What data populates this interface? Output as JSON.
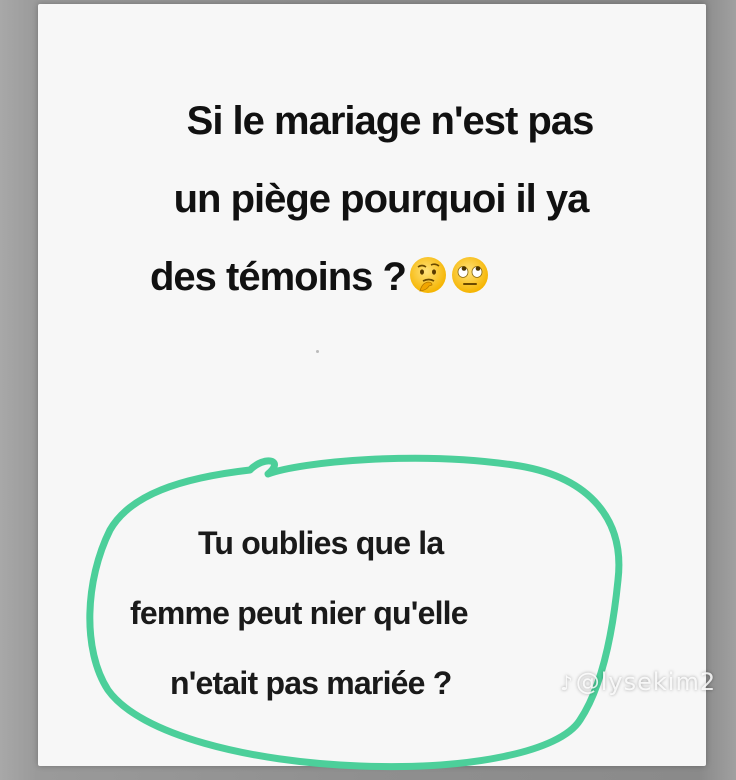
{
  "question": {
    "line1": "Si le mariage n'est pas",
    "line2": "un piège pourquoi il ya",
    "line3": "des témoins ?",
    "emojis": [
      "thinking-face-icon",
      "rolling-eyes-icon"
    ]
  },
  "answer": {
    "line1": "Tu oublies que la",
    "line2": "femme peut nier qu'elle",
    "line3": "n'etait  pas mariée ?"
  },
  "watermark": {
    "icon": "tiktok-icon",
    "text": "@lysekim2"
  },
  "colors": {
    "circle": "#4ccf9a",
    "card": "#f7f7f7",
    "frame": "#8f8f8f"
  }
}
